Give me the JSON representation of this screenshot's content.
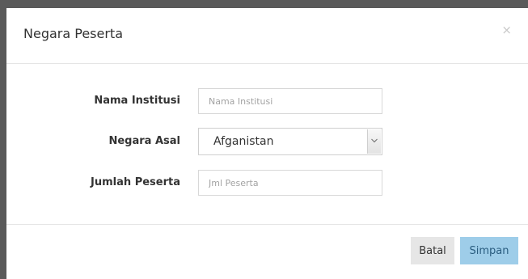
{
  "modal": {
    "title": "Negara Peserta",
    "close_label": "×"
  },
  "form": {
    "institusi": {
      "label": "Nama Institusi",
      "placeholder": "Nama Institusi",
      "value": ""
    },
    "negara": {
      "label": "Negara Asal",
      "selected": "Afganistan"
    },
    "jumlah": {
      "label": "Jumlah Peserta",
      "placeholder": "Jml Peserta",
      "value": ""
    }
  },
  "footer": {
    "cancel_label": "Batal",
    "save_label": "Simpan"
  },
  "colors": {
    "save_button_bg": "#9ecde9",
    "cancel_button_bg": "#e6e6e6",
    "backdrop": "#5a5a5a"
  },
  "icons": {
    "close": "close-icon",
    "select_arrow": "chevron-down-icon"
  }
}
